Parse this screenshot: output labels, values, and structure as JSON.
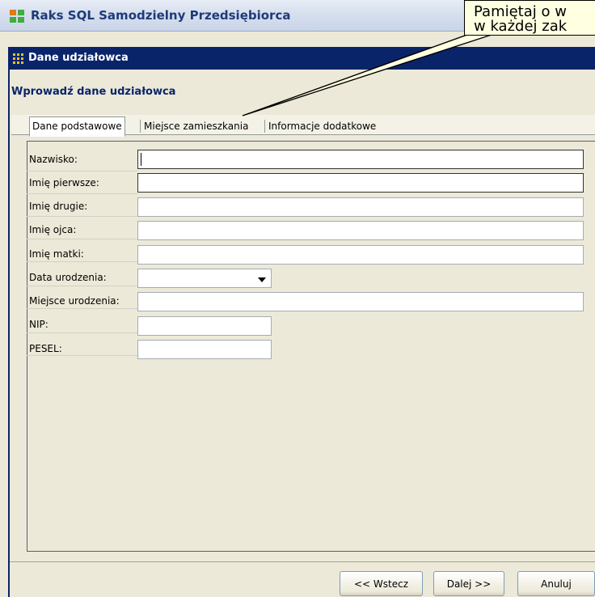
{
  "app": {
    "title": "Raks SQL Samodzielny Przedsiębiorca"
  },
  "dialog": {
    "title": "Dane udziałowca",
    "section_title": "Wprowadź dane udziałowca"
  },
  "tabs": [
    {
      "label": "Dane podstawowe",
      "active": true
    },
    {
      "label": "Miejsce zamieszkania",
      "active": false
    },
    {
      "label": "Informacje dodatkowe",
      "active": false
    }
  ],
  "form": {
    "fields": [
      {
        "label": "Nazwisko:",
        "value": ""
      },
      {
        "label": "Imię pierwsze:",
        "value": ""
      },
      {
        "label": "Imię drugie:",
        "value": ""
      },
      {
        "label": "Imię ojca:",
        "value": ""
      },
      {
        "label": "Imię matki:",
        "value": ""
      },
      {
        "label": "Data urodzenia:",
        "value": ""
      },
      {
        "label": "Miejsce urodzenia:",
        "value": ""
      },
      {
        "label": "NIP:",
        "value": ""
      },
      {
        "label": "PESEL:",
        "value": ""
      }
    ]
  },
  "buttons": {
    "back": "<< Wstecz",
    "next": "Dalej >>",
    "cancel": "Anuluj"
  },
  "callout": {
    "line1": "Pamiętaj o w",
    "line2": "w każdej zak"
  },
  "colors": {
    "header_bg": "#0a246a",
    "callout_bg": "#ffffe1",
    "window_bg": "#ece9d8"
  }
}
